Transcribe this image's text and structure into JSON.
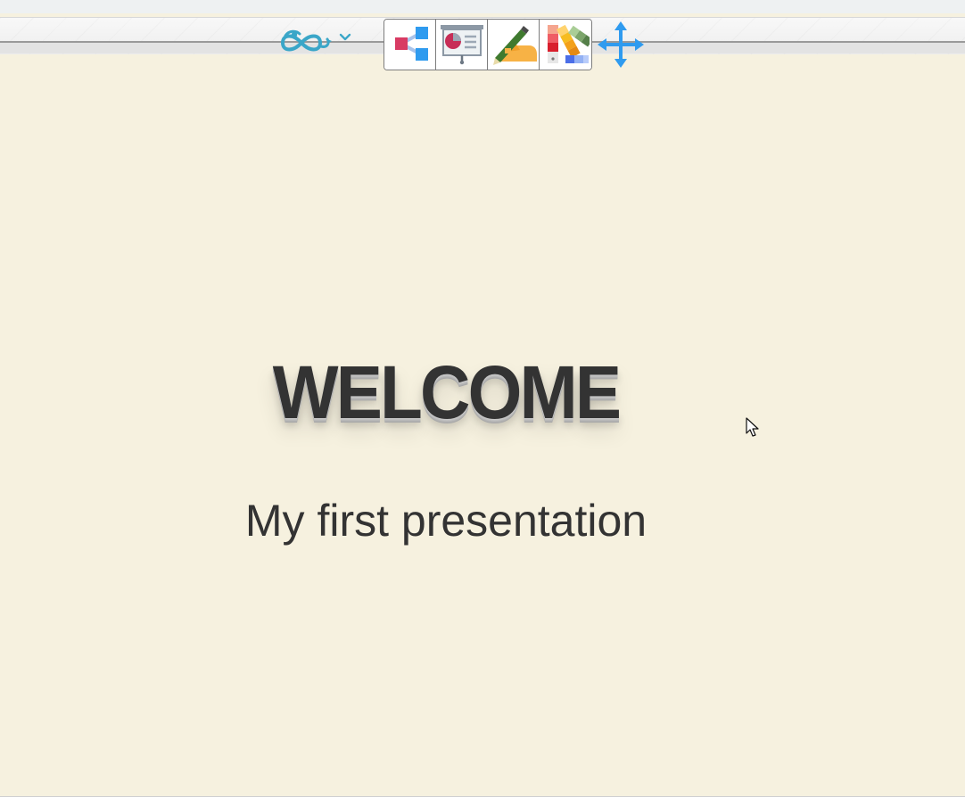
{
  "toolbar": {
    "brand": {
      "icon": "infinity-logo-icon",
      "dropdown_icon": "chevron-down-icon",
      "color": "#3aa6c8"
    },
    "tools": [
      {
        "name": "share",
        "icon": "share-icon"
      },
      {
        "name": "presentation",
        "icon": "presentation-board-icon"
      },
      {
        "name": "edit",
        "icon": "pen-hand-icon"
      },
      {
        "name": "palette",
        "icon": "color-swatch-icon"
      }
    ],
    "move_icon": "move-icon"
  },
  "slide": {
    "title": "WELCOME",
    "subtitle": "My first presentation",
    "background": "#f6f1df",
    "text_color": "#333333"
  }
}
